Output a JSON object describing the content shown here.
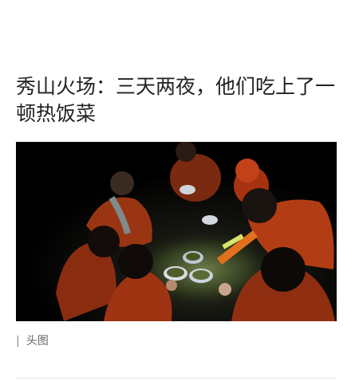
{
  "article": {
    "title": "秀山火场：三天两夜，他们吃上了一顿热饭菜",
    "image_alt": "消防员围坐在夜色中吃饭",
    "caption_separator": "|",
    "caption": "头图"
  }
}
